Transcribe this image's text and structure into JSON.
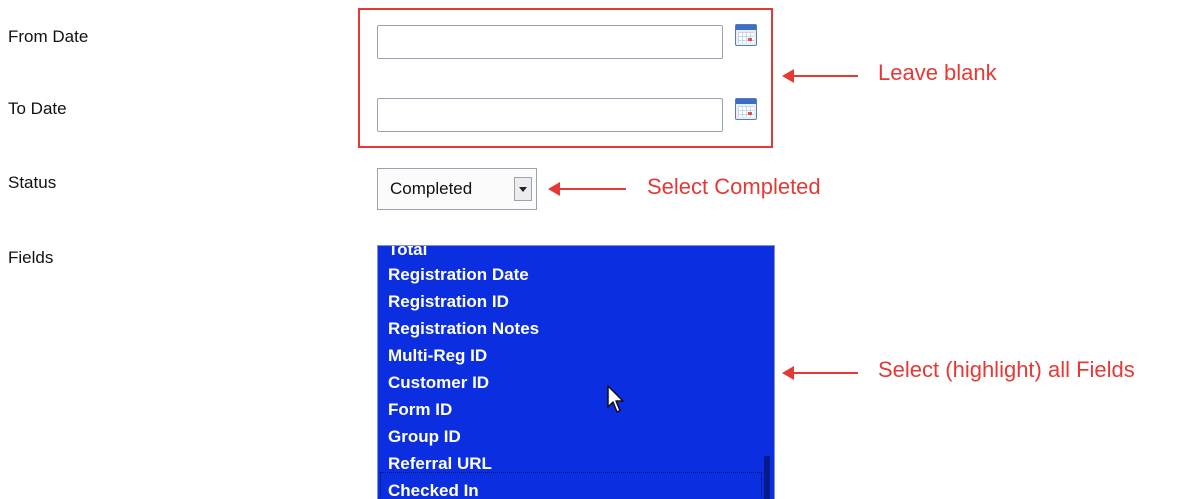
{
  "form": {
    "from_date_label": "From Date",
    "to_date_label": "To Date",
    "status_label": "Status",
    "fields_label": "Fields",
    "from_date_value": "",
    "to_date_value": "",
    "status_selected": "Completed",
    "fields_options": [
      "Total",
      "Registration Date",
      "Registration ID",
      "Registration Notes",
      "Multi-Reg ID",
      "Customer ID",
      "Form ID",
      "Group ID",
      "Referral URL",
      "Checked In"
    ]
  },
  "annotations": {
    "dates_note": "Leave blank",
    "status_note": "Select Completed",
    "fields_note": "Select (highlight) all Fields"
  },
  "colors": {
    "annotation": "#e53935",
    "list_selected_bg": "#0b2fe0",
    "list_selected_text": "#ffffff"
  },
  "icons": {
    "date_picker": "calendar-icon",
    "cursor": "mouse-pointer-icon"
  }
}
